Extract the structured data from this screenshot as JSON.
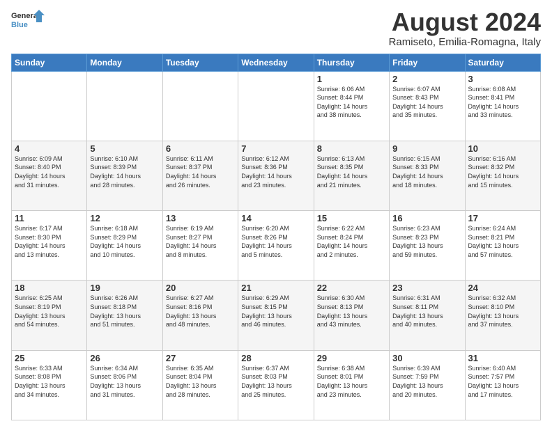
{
  "logo": {
    "line1": "General",
    "line2": "Blue"
  },
  "title": "August 2024",
  "subtitle": "Ramiseto, Emilia-Romagna, Italy",
  "weekdays": [
    "Sunday",
    "Monday",
    "Tuesday",
    "Wednesday",
    "Thursday",
    "Friday",
    "Saturday"
  ],
  "weeks": [
    [
      {
        "day": "",
        "info": ""
      },
      {
        "day": "",
        "info": ""
      },
      {
        "day": "",
        "info": ""
      },
      {
        "day": "",
        "info": ""
      },
      {
        "day": "1",
        "info": "Sunrise: 6:06 AM\nSunset: 8:44 PM\nDaylight: 14 hours\nand 38 minutes."
      },
      {
        "day": "2",
        "info": "Sunrise: 6:07 AM\nSunset: 8:43 PM\nDaylight: 14 hours\nand 35 minutes."
      },
      {
        "day": "3",
        "info": "Sunrise: 6:08 AM\nSunset: 8:41 PM\nDaylight: 14 hours\nand 33 minutes."
      }
    ],
    [
      {
        "day": "4",
        "info": "Sunrise: 6:09 AM\nSunset: 8:40 PM\nDaylight: 14 hours\nand 31 minutes."
      },
      {
        "day": "5",
        "info": "Sunrise: 6:10 AM\nSunset: 8:39 PM\nDaylight: 14 hours\nand 28 minutes."
      },
      {
        "day": "6",
        "info": "Sunrise: 6:11 AM\nSunset: 8:37 PM\nDaylight: 14 hours\nand 26 minutes."
      },
      {
        "day": "7",
        "info": "Sunrise: 6:12 AM\nSunset: 8:36 PM\nDaylight: 14 hours\nand 23 minutes."
      },
      {
        "day": "8",
        "info": "Sunrise: 6:13 AM\nSunset: 8:35 PM\nDaylight: 14 hours\nand 21 minutes."
      },
      {
        "day": "9",
        "info": "Sunrise: 6:15 AM\nSunset: 8:33 PM\nDaylight: 14 hours\nand 18 minutes."
      },
      {
        "day": "10",
        "info": "Sunrise: 6:16 AM\nSunset: 8:32 PM\nDaylight: 14 hours\nand 15 minutes."
      }
    ],
    [
      {
        "day": "11",
        "info": "Sunrise: 6:17 AM\nSunset: 8:30 PM\nDaylight: 14 hours\nand 13 minutes."
      },
      {
        "day": "12",
        "info": "Sunrise: 6:18 AM\nSunset: 8:29 PM\nDaylight: 14 hours\nand 10 minutes."
      },
      {
        "day": "13",
        "info": "Sunrise: 6:19 AM\nSunset: 8:27 PM\nDaylight: 14 hours\nand 8 minutes."
      },
      {
        "day": "14",
        "info": "Sunrise: 6:20 AM\nSunset: 8:26 PM\nDaylight: 14 hours\nand 5 minutes."
      },
      {
        "day": "15",
        "info": "Sunrise: 6:22 AM\nSunset: 8:24 PM\nDaylight: 14 hours\nand 2 minutes."
      },
      {
        "day": "16",
        "info": "Sunrise: 6:23 AM\nSunset: 8:23 PM\nDaylight: 13 hours\nand 59 minutes."
      },
      {
        "day": "17",
        "info": "Sunrise: 6:24 AM\nSunset: 8:21 PM\nDaylight: 13 hours\nand 57 minutes."
      }
    ],
    [
      {
        "day": "18",
        "info": "Sunrise: 6:25 AM\nSunset: 8:19 PM\nDaylight: 13 hours\nand 54 minutes."
      },
      {
        "day": "19",
        "info": "Sunrise: 6:26 AM\nSunset: 8:18 PM\nDaylight: 13 hours\nand 51 minutes."
      },
      {
        "day": "20",
        "info": "Sunrise: 6:27 AM\nSunset: 8:16 PM\nDaylight: 13 hours\nand 48 minutes."
      },
      {
        "day": "21",
        "info": "Sunrise: 6:29 AM\nSunset: 8:15 PM\nDaylight: 13 hours\nand 46 minutes."
      },
      {
        "day": "22",
        "info": "Sunrise: 6:30 AM\nSunset: 8:13 PM\nDaylight: 13 hours\nand 43 minutes."
      },
      {
        "day": "23",
        "info": "Sunrise: 6:31 AM\nSunset: 8:11 PM\nDaylight: 13 hours\nand 40 minutes."
      },
      {
        "day": "24",
        "info": "Sunrise: 6:32 AM\nSunset: 8:10 PM\nDaylight: 13 hours\nand 37 minutes."
      }
    ],
    [
      {
        "day": "25",
        "info": "Sunrise: 6:33 AM\nSunset: 8:08 PM\nDaylight: 13 hours\nand 34 minutes."
      },
      {
        "day": "26",
        "info": "Sunrise: 6:34 AM\nSunset: 8:06 PM\nDaylight: 13 hours\nand 31 minutes."
      },
      {
        "day": "27",
        "info": "Sunrise: 6:35 AM\nSunset: 8:04 PM\nDaylight: 13 hours\nand 28 minutes."
      },
      {
        "day": "28",
        "info": "Sunrise: 6:37 AM\nSunset: 8:03 PM\nDaylight: 13 hours\nand 25 minutes."
      },
      {
        "day": "29",
        "info": "Sunrise: 6:38 AM\nSunset: 8:01 PM\nDaylight: 13 hours\nand 23 minutes."
      },
      {
        "day": "30",
        "info": "Sunrise: 6:39 AM\nSunset: 7:59 PM\nDaylight: 13 hours\nand 20 minutes."
      },
      {
        "day": "31",
        "info": "Sunrise: 6:40 AM\nSunset: 7:57 PM\nDaylight: 13 hours\nand 17 minutes."
      }
    ]
  ]
}
